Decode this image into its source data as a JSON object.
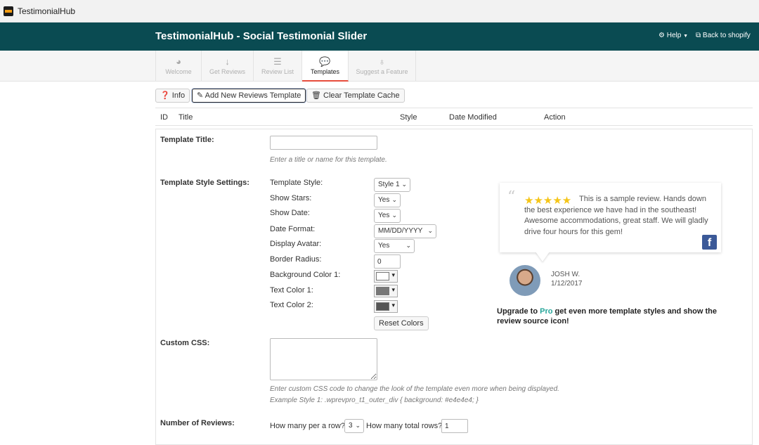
{
  "app": {
    "name": "TestimonialHub"
  },
  "header": {
    "title": "TestimonialHub - Social Testimonial Slider",
    "help_label": "Help",
    "back_label": "Back to shopify"
  },
  "tabs": [
    {
      "label": "Welcome",
      "icon": "dashboard-icon"
    },
    {
      "label": "Get Reviews",
      "icon": "download-icon"
    },
    {
      "label": "Review List",
      "icon": "list-icon"
    },
    {
      "label": "Templates",
      "icon": "comments-icon"
    },
    {
      "label": "Suggest a Feature",
      "icon": "lightbulb-icon"
    }
  ],
  "toolbar": {
    "info_label": "Info",
    "add_label": "Add New Reviews Template",
    "clear_label": "Clear Template Cache"
  },
  "table": {
    "columns": [
      "ID",
      "Title",
      "Style",
      "Date Modified",
      "Action"
    ]
  },
  "form": {
    "template_title_label": "Template Title:",
    "template_title_value": "",
    "template_title_hint": "Enter a title or name for this template.",
    "style_settings_label": "Template Style Settings:",
    "fields": {
      "style": {
        "label": "Template Style:",
        "value": "Style 1"
      },
      "stars": {
        "label": "Show Stars:",
        "value": "Yes"
      },
      "date": {
        "label": "Show Date:",
        "value": "Yes"
      },
      "date_format": {
        "label": "Date Format:",
        "value": "MM/DD/YYYY"
      },
      "avatar": {
        "label": "Display Avatar:",
        "value": "Yes"
      },
      "radius": {
        "label": "Border Radius:",
        "value": "0"
      },
      "bg1": {
        "label": "Background Color 1:",
        "color": "#ffffff"
      },
      "text1": {
        "label": "Text Color 1:",
        "color": "#777777"
      },
      "text2": {
        "label": "Text Color 2:",
        "color": "#555555"
      }
    },
    "reset_label": "Reset Colors",
    "custom_css_label": "Custom CSS:",
    "custom_css_value": "",
    "custom_css_hint1": "Enter custom CSS code to change the look of the template even more when being displayed.",
    "custom_css_hint2": "Example Style 1: .wprevpro_t1_outer_div { background: #e4e4e4; }",
    "num_reviews_label": "Number of Reviews:",
    "per_row_label": "How many per a row?",
    "per_row_value": "3",
    "total_rows_label": "How many total rows?",
    "total_rows_value": "1"
  },
  "preview": {
    "stars": "★★★★★",
    "review": "This is a sample review. Hands down the best experience we have had in the southeast! Awesome accommodations, great staff. We will gladly drive four hours for this gem!",
    "reviewer_name": "JOSH W.",
    "review_date": "1/12/2017",
    "pro_prefix": "Upgrade to ",
    "pro_word": "Pro",
    "pro_suffix": " get even more template styles and show the review source icon!"
  }
}
